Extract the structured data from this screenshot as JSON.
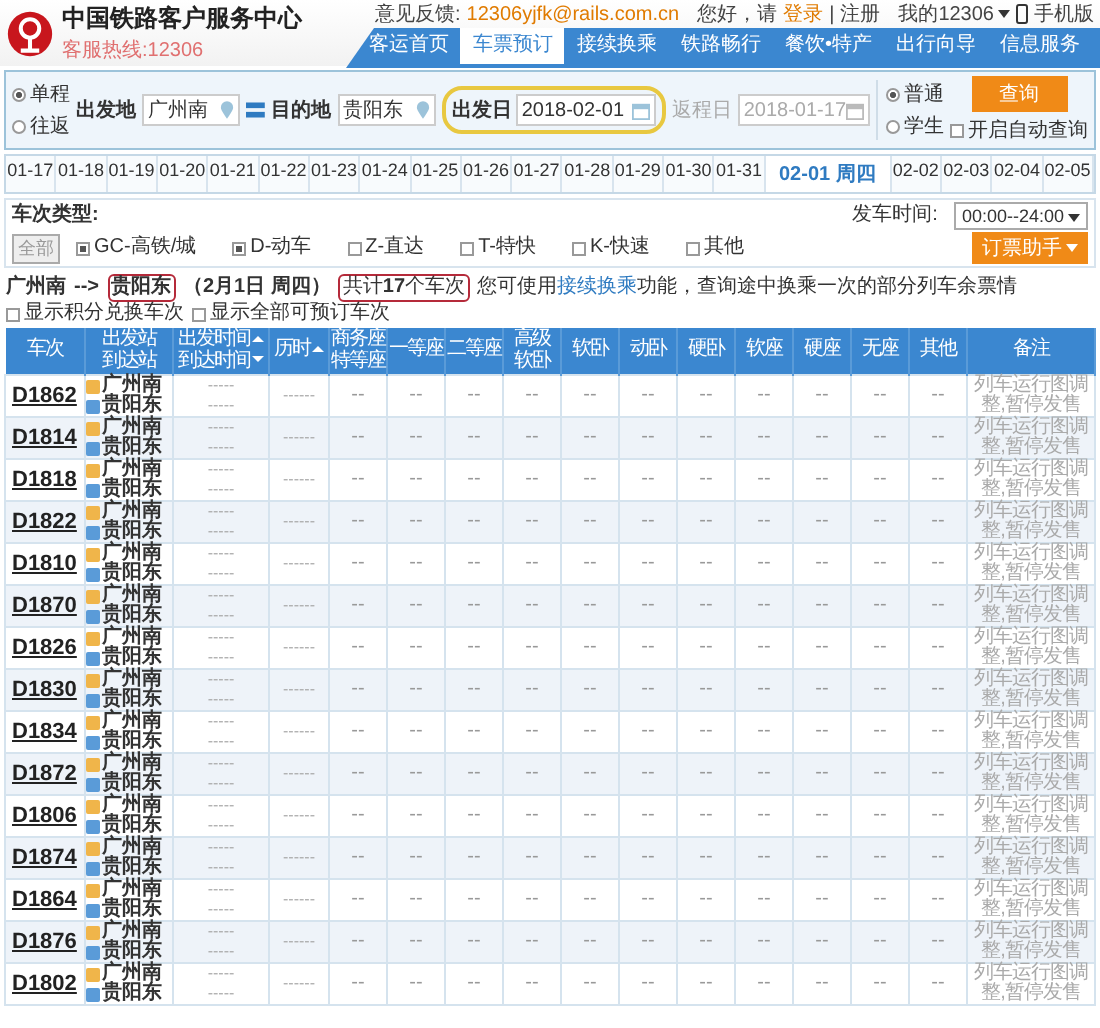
{
  "header": {
    "site_title": "中国铁路客户服务中心",
    "hotline": "客服热线:12306",
    "feedback_label": "意见反馈:",
    "feedback_email": "12306yjfk@rails.com.cn",
    "greeting": "您好，请",
    "login": "登录",
    "separator": "|",
    "register": "注册",
    "account": "我的12306",
    "mobile": "手机版"
  },
  "nav": [
    {
      "label": "客运首页",
      "selected": false
    },
    {
      "label": "车票预订",
      "selected": true
    },
    {
      "label": "接续换乘",
      "selected": false
    },
    {
      "label": "铁路畅行",
      "selected": false
    },
    {
      "label": "餐饮•特产",
      "selected": false
    },
    {
      "label": "出行向导",
      "selected": false
    },
    {
      "label": "信息服务",
      "selected": false
    }
  ],
  "search": {
    "trip_types": [
      {
        "label": "单程",
        "selected": true
      },
      {
        "label": "往返",
        "selected": false
      }
    ],
    "from": {
      "label": "出发地",
      "value": "广州南"
    },
    "to": {
      "label": "目的地",
      "value": "贵阳东"
    },
    "depart": {
      "label": "出发日",
      "value": "2018-02-01",
      "highlighted": true
    },
    "return": {
      "label": "返程日",
      "value": "2018-01-17",
      "disabled": true
    },
    "passenger_types": [
      {
        "label": "普通",
        "selected": true
      },
      {
        "label": "学生",
        "selected": false
      }
    ],
    "query_button": "查询",
    "auto_query": {
      "label": "开启自动查询",
      "checked": false
    }
  },
  "dates": [
    {
      "label": "01-17",
      "selected": false
    },
    {
      "label": "01-18",
      "selected": false
    },
    {
      "label": "01-19",
      "selected": false
    },
    {
      "label": "01-20",
      "selected": false
    },
    {
      "label": "01-21",
      "selected": false
    },
    {
      "label": "01-22",
      "selected": false
    },
    {
      "label": "01-23",
      "selected": false
    },
    {
      "label": "01-24",
      "selected": false
    },
    {
      "label": "01-25",
      "selected": false
    },
    {
      "label": "01-26",
      "selected": false
    },
    {
      "label": "01-27",
      "selected": false
    },
    {
      "label": "01-28",
      "selected": false
    },
    {
      "label": "01-29",
      "selected": false
    },
    {
      "label": "01-30",
      "selected": false
    },
    {
      "label": "01-31",
      "selected": false
    },
    {
      "label": "02-01 周四",
      "selected": true
    },
    {
      "label": "02-02",
      "selected": false
    },
    {
      "label": "02-03",
      "selected": false
    },
    {
      "label": "02-04",
      "selected": false
    },
    {
      "label": "02-05",
      "selected": false
    }
  ],
  "filters": {
    "title": "车次类型:",
    "all": "全部",
    "types": [
      {
        "label": "GC-高铁/城",
        "checked": true
      },
      {
        "label": "D-动车",
        "checked": true
      },
      {
        "label": "Z-直达",
        "checked": false
      },
      {
        "label": "T-特快",
        "checked": false
      },
      {
        "label": "K-快速",
        "checked": false
      },
      {
        "label": "其他",
        "checked": false
      }
    ],
    "time_label": "发车时间:",
    "time_value": "00:00--24:00",
    "helper_button": "订票助手"
  },
  "summary": {
    "from": "广州南",
    "arrow": "-->",
    "to": "贵阳东",
    "to_highlighted": true,
    "date": "（2月1日  周四）",
    "count": "共计**17**个车次",
    "count_highlighted": true,
    "notice_prefix": "您可使用",
    "notice_link": "接续换乘",
    "notice_suffix": "功能，查询途中换乘一次的部分列车余票情",
    "options": [
      {
        "label": "显示积分兑换车次",
        "checked": false
      },
      {
        "label": "显示全部可预订车次",
        "checked": false
      }
    ]
  },
  "table": {
    "columns": [
      {
        "lines": [
          "车次"
        ],
        "sortable": false
      },
      {
        "lines": [
          "出发站",
          "到达站"
        ],
        "sortable": false
      },
      {
        "lines": [
          "出发时间",
          "到达时间"
        ],
        "sortable": true
      },
      {
        "lines": [
          "历时"
        ],
        "sortable": true
      },
      {
        "lines": [
          "商务座",
          "特等座"
        ],
        "sortable": false
      },
      {
        "lines": [
          "一等座"
        ],
        "sortable": false
      },
      {
        "lines": [
          "二等座"
        ],
        "sortable": false
      },
      {
        "lines": [
          "高级",
          "软卧"
        ],
        "sortable": false
      },
      {
        "lines": [
          "软卧"
        ],
        "sortable": false
      },
      {
        "lines": [
          "动卧"
        ],
        "sortable": false
      },
      {
        "lines": [
          "硬卧"
        ],
        "sortable": false
      },
      {
        "lines": [
          "软座"
        ],
        "sortable": false
      },
      {
        "lines": [
          "硬座"
        ],
        "sortable": false
      },
      {
        "lines": [
          "无座"
        ],
        "sortable": false
      },
      {
        "lines": [
          "其他"
        ],
        "sortable": false
      },
      {
        "lines": [
          "备注"
        ],
        "sortable": false
      }
    ],
    "rows": [
      {
        "train": "D1862",
        "from": "广州南",
        "to": "贵阳东",
        "depart": "-----",
        "arrive": "-----",
        "duration": "------",
        "seats": [
          "--",
          "--",
          "--",
          "--",
          "--",
          "--",
          "--",
          "--",
          "--",
          "--",
          "--"
        ],
        "note": "列车运行图调整,暂停发售"
      },
      {
        "train": "D1814",
        "from": "广州南",
        "to": "贵阳东",
        "depart": "-----",
        "arrive": "-----",
        "duration": "------",
        "seats": [
          "--",
          "--",
          "--",
          "--",
          "--",
          "--",
          "--",
          "--",
          "--",
          "--",
          "--"
        ],
        "note": "列车运行图调整,暂停发售"
      },
      {
        "train": "D1818",
        "from": "广州南",
        "to": "贵阳东",
        "depart": "-----",
        "arrive": "-----",
        "duration": "------",
        "seats": [
          "--",
          "--",
          "--",
          "--",
          "--",
          "--",
          "--",
          "--",
          "--",
          "--",
          "--"
        ],
        "note": "列车运行图调整,暂停发售"
      },
      {
        "train": "D1822",
        "from": "广州南",
        "to": "贵阳东",
        "depart": "-----",
        "arrive": "-----",
        "duration": "------",
        "seats": [
          "--",
          "--",
          "--",
          "--",
          "--",
          "--",
          "--",
          "--",
          "--",
          "--",
          "--"
        ],
        "note": "列车运行图调整,暂停发售"
      },
      {
        "train": "D1810",
        "from": "广州南",
        "to": "贵阳东",
        "depart": "-----",
        "arrive": "-----",
        "duration": "------",
        "seats": [
          "--",
          "--",
          "--",
          "--",
          "--",
          "--",
          "--",
          "--",
          "--",
          "--",
          "--"
        ],
        "note": "列车运行图调整,暂停发售"
      },
      {
        "train": "D1870",
        "from": "广州南",
        "to": "贵阳东",
        "depart": "-----",
        "arrive": "-----",
        "duration": "------",
        "seats": [
          "--",
          "--",
          "--",
          "--",
          "--",
          "--",
          "--",
          "--",
          "--",
          "--",
          "--"
        ],
        "note": "列车运行图调整,暂停发售"
      },
      {
        "train": "D1826",
        "from": "广州南",
        "to": "贵阳东",
        "depart": "-----",
        "arrive": "-----",
        "duration": "------",
        "seats": [
          "--",
          "--",
          "--",
          "--",
          "--",
          "--",
          "--",
          "--",
          "--",
          "--",
          "--"
        ],
        "note": "列车运行图调整,暂停发售"
      },
      {
        "train": "D1830",
        "from": "广州南",
        "to": "贵阳东",
        "depart": "-----",
        "arrive": "-----",
        "duration": "------",
        "seats": [
          "--",
          "--",
          "--",
          "--",
          "--",
          "--",
          "--",
          "--",
          "--",
          "--",
          "--"
        ],
        "note": "列车运行图调整,暂停发售"
      },
      {
        "train": "D1834",
        "from": "广州南",
        "to": "贵阳东",
        "depart": "-----",
        "arrive": "-----",
        "duration": "------",
        "seats": [
          "--",
          "--",
          "--",
          "--",
          "--",
          "--",
          "--",
          "--",
          "--",
          "--",
          "--"
        ],
        "note": "列车运行图调整,暂停发售"
      },
      {
        "train": "D1872",
        "from": "广州南",
        "to": "贵阳东",
        "depart": "-----",
        "arrive": "-----",
        "duration": "------",
        "seats": [
          "--",
          "--",
          "--",
          "--",
          "--",
          "--",
          "--",
          "--",
          "--",
          "--",
          "--"
        ],
        "note": "列车运行图调整,暂停发售"
      },
      {
        "train": "D1806",
        "from": "广州南",
        "to": "贵阳东",
        "depart": "-----",
        "arrive": "-----",
        "duration": "------",
        "seats": [
          "--",
          "--",
          "--",
          "--",
          "--",
          "--",
          "--",
          "--",
          "--",
          "--",
          "--"
        ],
        "note": "列车运行图调整,暂停发售"
      },
      {
        "train": "D1874",
        "from": "广州南",
        "to": "贵阳东",
        "depart": "-----",
        "arrive": "-----",
        "duration": "------",
        "seats": [
          "--",
          "--",
          "--",
          "--",
          "--",
          "--",
          "--",
          "--",
          "--",
          "--",
          "--"
        ],
        "note": "列车运行图调整,暂停发售"
      },
      {
        "train": "D1864",
        "from": "广州南",
        "to": "贵阳东",
        "depart": "-----",
        "arrive": "-----",
        "duration": "------",
        "seats": [
          "--",
          "--",
          "--",
          "--",
          "--",
          "--",
          "--",
          "--",
          "--",
          "--",
          "--"
        ],
        "note": "列车运行图调整,暂停发售"
      },
      {
        "train": "D1876",
        "from": "广州南",
        "to": "贵阳东",
        "depart": "-----",
        "arrive": "-----",
        "duration": "------",
        "seats": [
          "--",
          "--",
          "--",
          "--",
          "--",
          "--",
          "--",
          "--",
          "--",
          "--",
          "--"
        ],
        "note": "列车运行图调整,暂停发售"
      },
      {
        "train": "D1802",
        "from": "广州南",
        "to": "贵阳东",
        "depart": "-----",
        "arrive": "-----",
        "duration": "------",
        "seats": [
          "--",
          "--",
          "--",
          "--",
          "--",
          "--",
          "--",
          "--",
          "--",
          "--",
          "--"
        ],
        "note": "列车运行图调整,暂停发售"
      }
    ]
  }
}
